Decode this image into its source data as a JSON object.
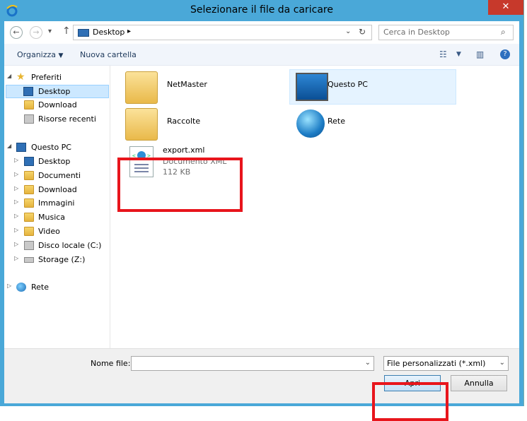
{
  "window": {
    "title": "Selezionare il file da caricare",
    "close_glyph": "✕"
  },
  "addressbar": {
    "path": "Desktop",
    "search_placeholder": "Cerca in Desktop"
  },
  "toolbar": {
    "organize_label": "Organizza",
    "new_folder_label": "Nuova cartella"
  },
  "nav": {
    "favorites": {
      "label": "Preferiti",
      "items": [
        {
          "label": "Desktop"
        },
        {
          "label": "Download"
        },
        {
          "label": "Risorse recenti"
        }
      ]
    },
    "pc": {
      "label": "Questo PC",
      "items": [
        {
          "label": "Desktop"
        },
        {
          "label": "Documenti"
        },
        {
          "label": "Download"
        },
        {
          "label": "Immagini"
        },
        {
          "label": "Musica"
        },
        {
          "label": "Video"
        },
        {
          "label": "Disco locale (C:)"
        },
        {
          "label": "Storage (Z:)"
        }
      ]
    },
    "network": {
      "label": "Rete"
    }
  },
  "files": [
    {
      "name": "NetMaster",
      "icon": "user-folder-icon"
    },
    {
      "name": "Questo PC",
      "icon": "computer-icon"
    },
    {
      "name": "Raccolte",
      "icon": "libraries-folder-icon"
    },
    {
      "name": "Rete",
      "icon": "network-globe-icon"
    },
    {
      "name": "export.xml",
      "type": "Documento XML",
      "size": "112 KB",
      "icon": "xml-document-icon"
    }
  ],
  "bottom": {
    "filename_label": "Nome file:",
    "filename_value": "",
    "filter_value": "File personalizzati (*.xml)",
    "open_label": "Apri",
    "cancel_label": "Annulla"
  },
  "colors": {
    "titlebar": "#4aa8d8",
    "highlight_box": "#e8151c",
    "close_button": "#c7392b"
  }
}
